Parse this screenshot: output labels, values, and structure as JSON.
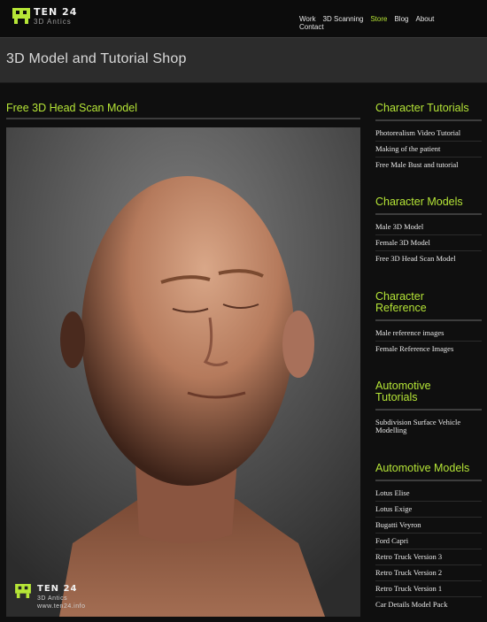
{
  "brand": {
    "name": "TEN 24",
    "tagline": "3D Antics"
  },
  "nav": {
    "items": [
      {
        "label": "Work",
        "active": false
      },
      {
        "label": "3D Scanning",
        "active": false
      },
      {
        "label": "Store",
        "active": true
      },
      {
        "label": "Blog",
        "active": false
      },
      {
        "label": "About",
        "active": false
      },
      {
        "label": "Contact",
        "active": false
      }
    ]
  },
  "page_title": "3D Model and Tutorial Shop",
  "main": {
    "heading": "Free 3D Head Scan Model",
    "image_alt": "3D head scan render",
    "watermark": {
      "name": "TEN 24",
      "tagline": "3D Antics",
      "url": "www.ten24.info"
    }
  },
  "sidebar": [
    {
      "title": "Character Tutorials",
      "items": [
        "Photorealism Video Tutorial",
        "Making of the patient",
        "Free Male Bust and tutorial"
      ]
    },
    {
      "title": "Character Models",
      "items": [
        "Male 3D Model",
        "Female 3D Model",
        "Free 3D Head Scan Model"
      ]
    },
    {
      "title": "Character Reference",
      "items": [
        "Male reference images",
        "Female Reference Images"
      ]
    },
    {
      "title": "Automotive Tutorials",
      "items": [
        "Subdivision Surface Vehicle Modelling"
      ]
    },
    {
      "title": "Automotive Models",
      "items": [
        "Lotus Elise",
        "Lotus Exige",
        "Bugatti Veyron",
        "Ford Capri",
        "Retro Truck Version 3",
        "Retro Truck Version 2",
        "Retro Truck Version 1",
        "Car Details Model Pack"
      ]
    }
  ],
  "colors": {
    "accent": "#b6e637",
    "background": "#0f0f0f",
    "titleband": "#2c2c2c"
  }
}
